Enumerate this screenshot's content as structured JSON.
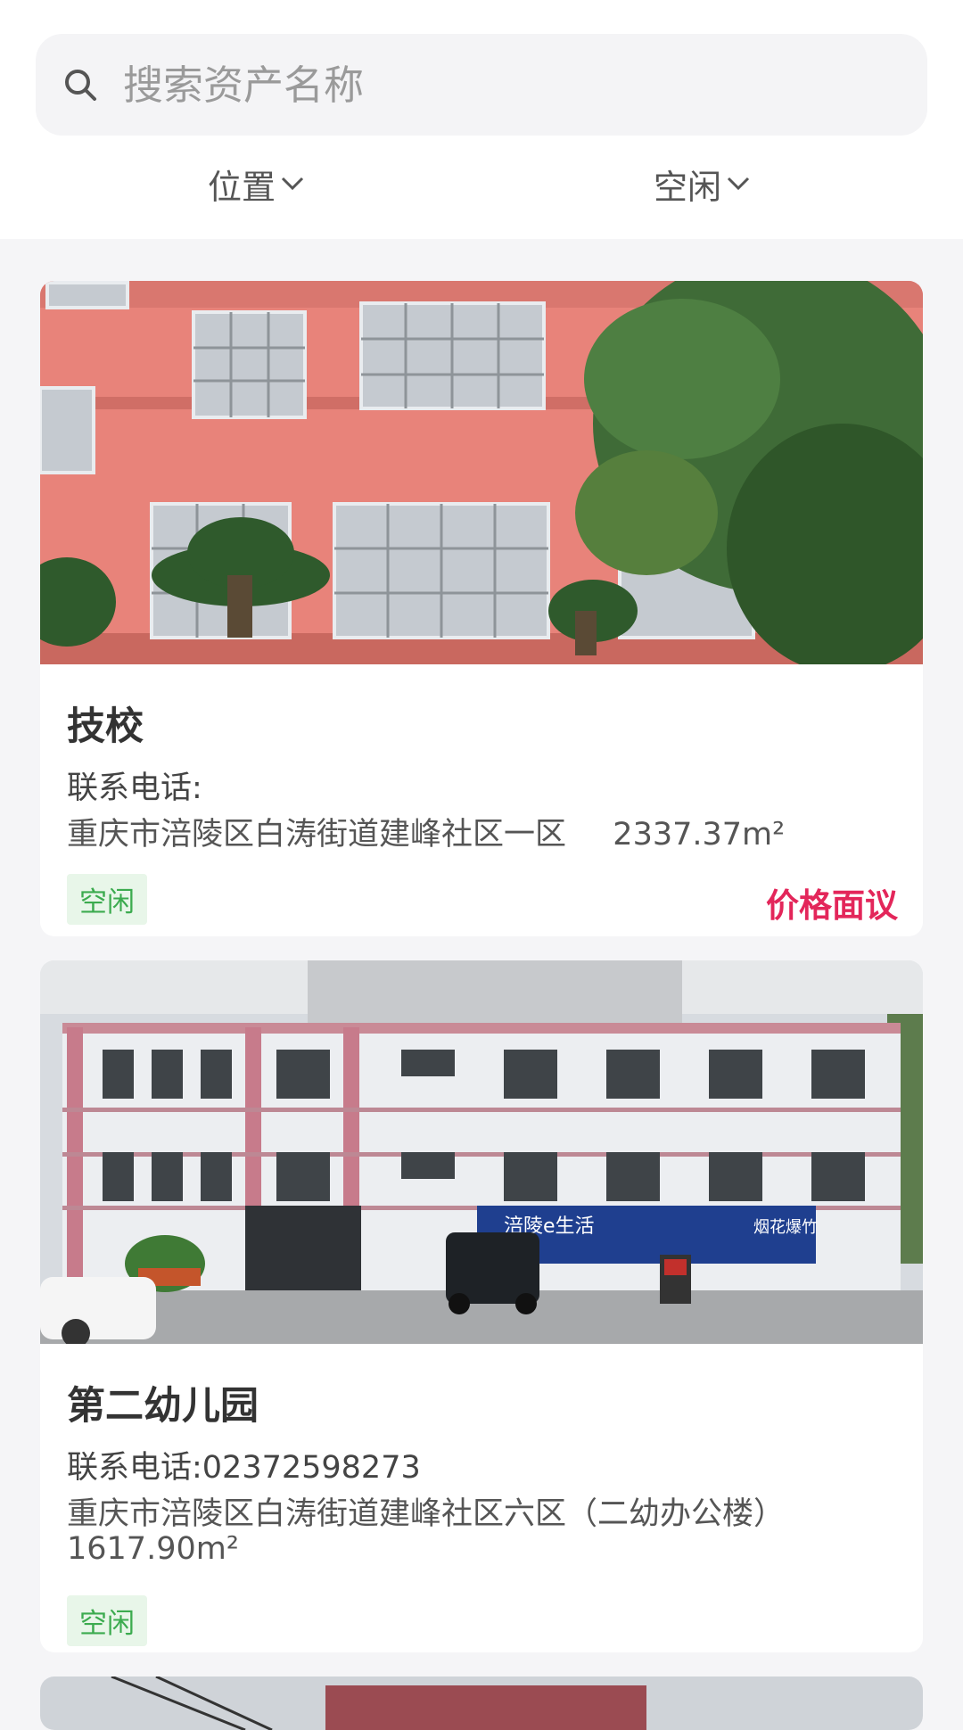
{
  "search": {
    "placeholder": "搜索资产名称"
  },
  "filters": {
    "location_label": "位置",
    "status_label": "空闲"
  },
  "listings": [
    {
      "title": "技校",
      "phone": "联系电话:",
      "address": "重庆市涪陵区白涛街道建峰社区一区",
      "area": "2337.37m²",
      "status": "空闲",
      "price": "价格面议"
    },
    {
      "title": "第二幼儿园",
      "phone": "联系电话:02372598273",
      "address": "重庆市涪陵区白涛街道建峰社区六区（二幼办公楼）",
      "area": "1617.90m²",
      "status": "空闲",
      "storefront_sign": "涪陵e生活",
      "storefront_sign_2": "烟花爆竹"
    }
  ],
  "colors": {
    "accent_price": "#e3265a",
    "status_green": "#3cab4f"
  }
}
